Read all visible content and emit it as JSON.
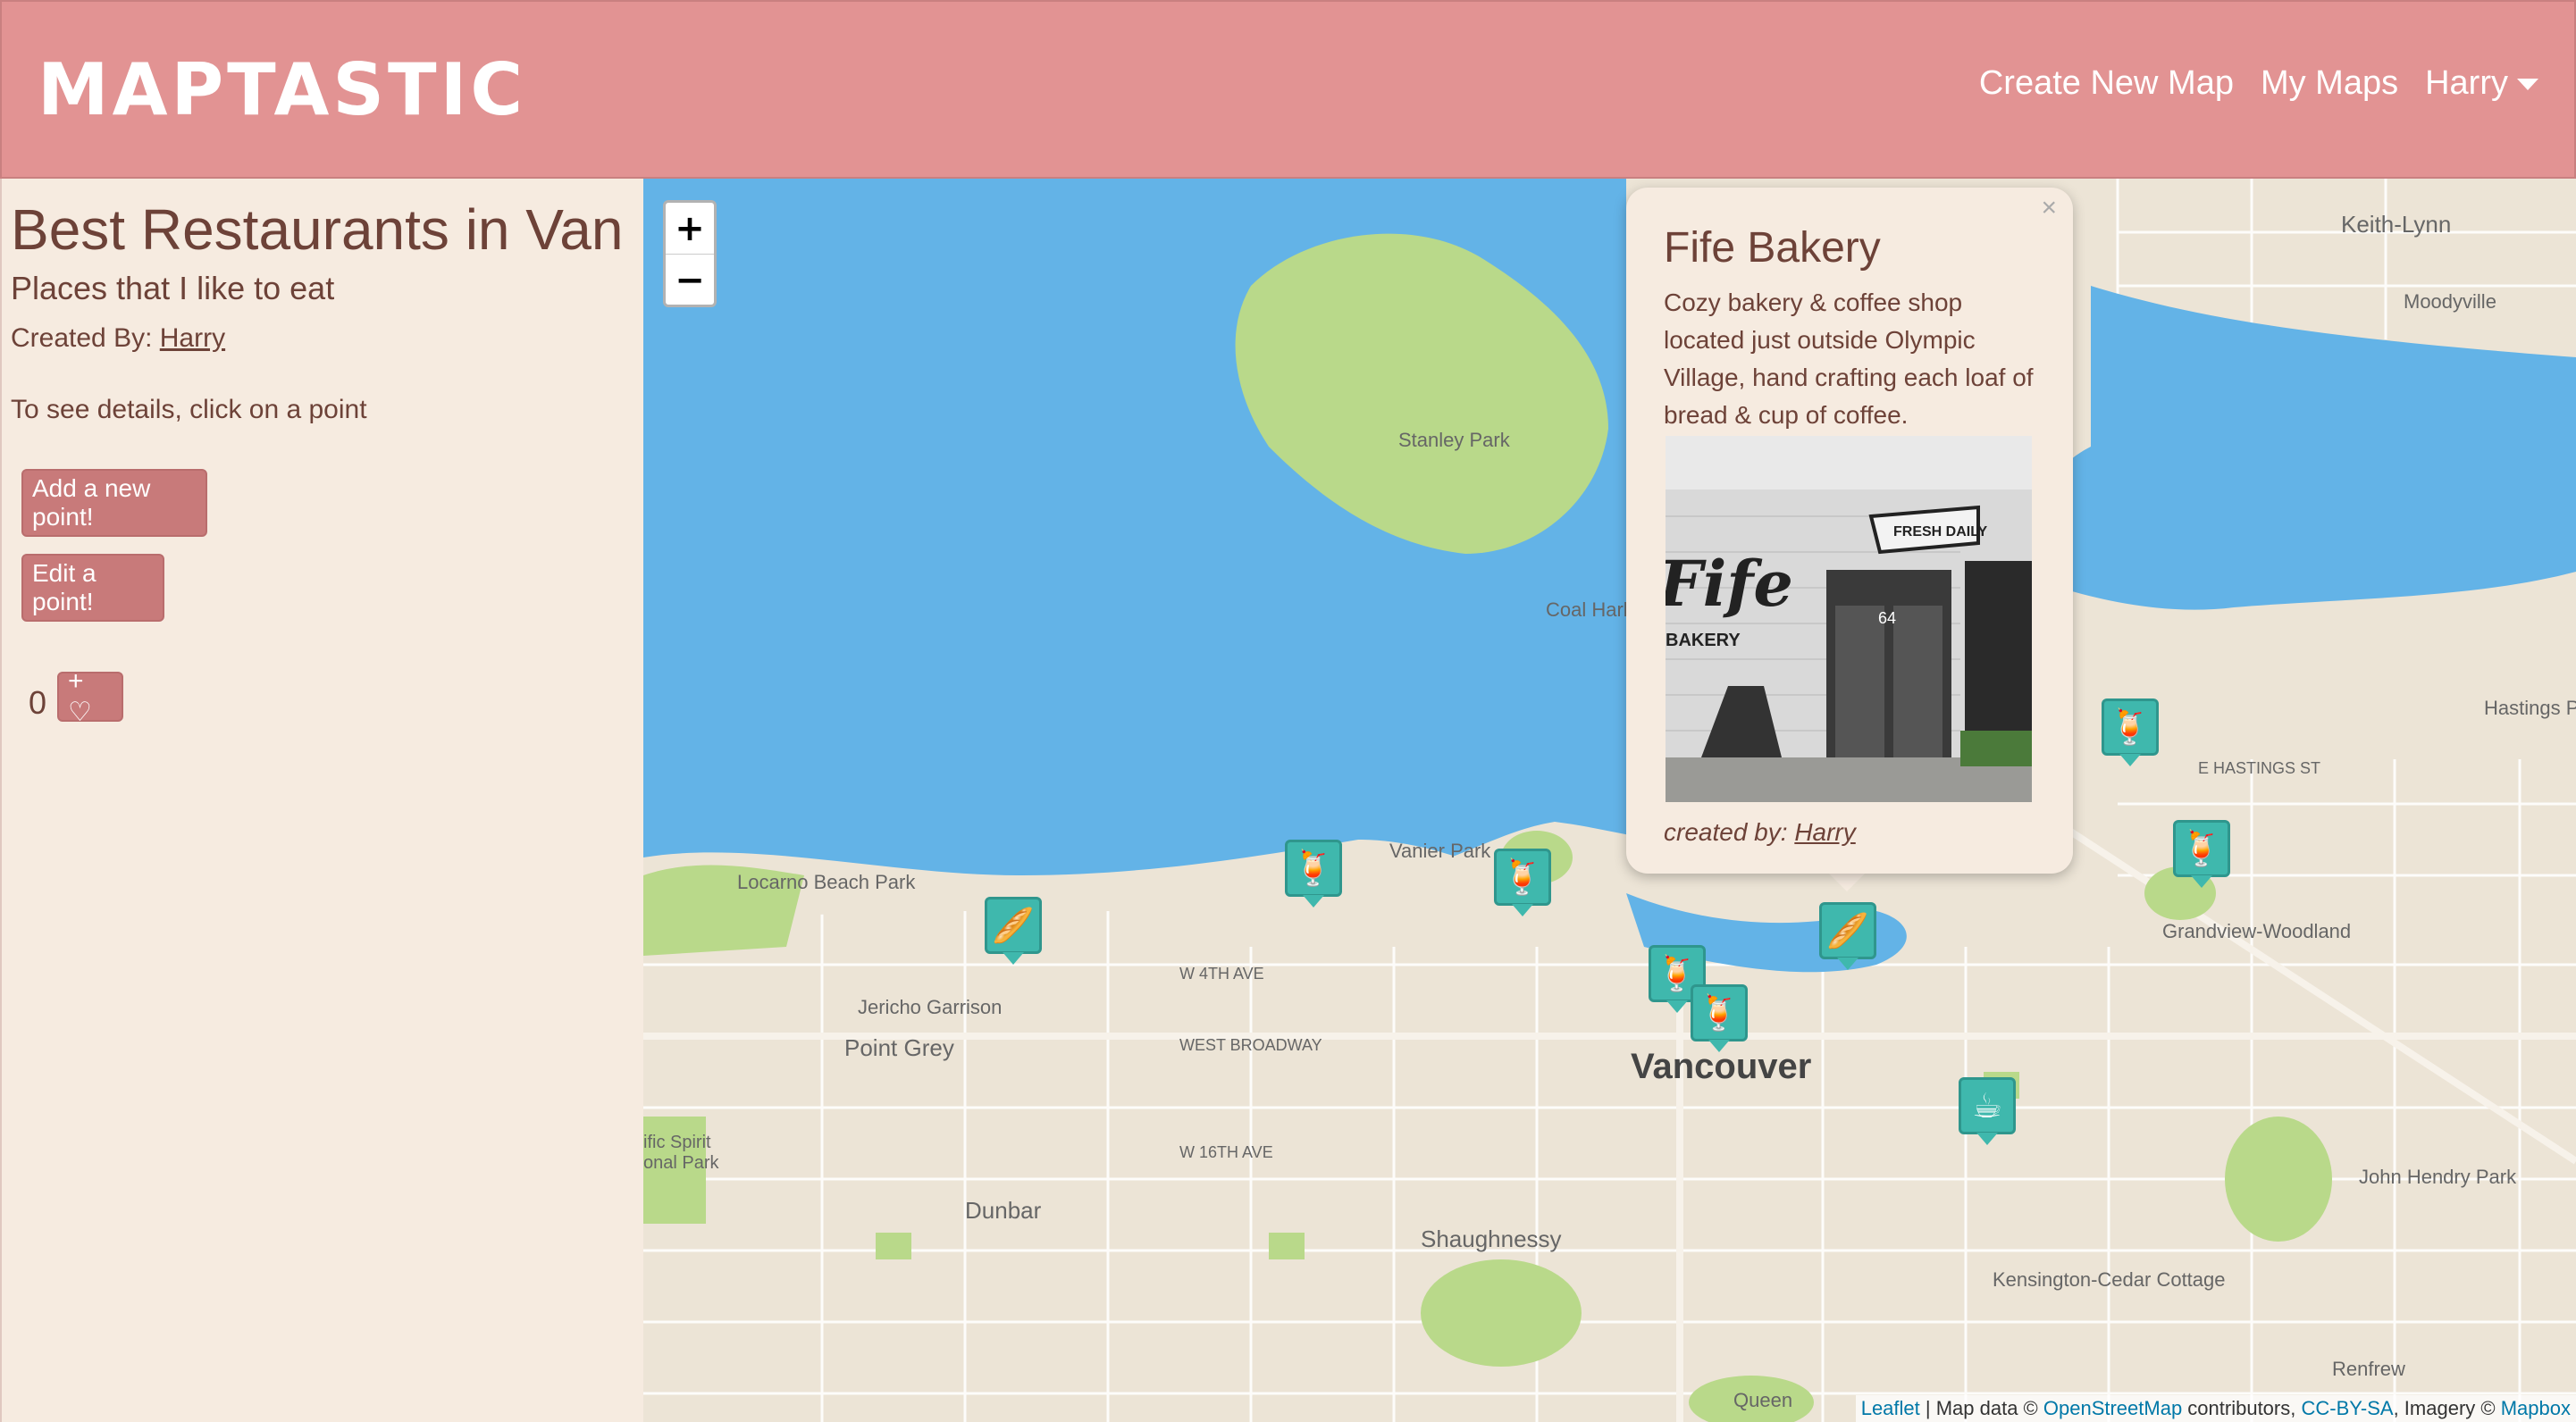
{
  "navbar": {
    "brand": "MAPTASTIC",
    "links": {
      "create": "Create New Map",
      "my_maps": "My Maps",
      "user": "Harry"
    }
  },
  "sidebar": {
    "title": "Best Restaurants in Van",
    "description": "Places that I like to eat",
    "created_by_label": "Created By:",
    "created_by_user": "Harry",
    "hint": "To see details, click on a point",
    "add_point_label": "Add a new point!",
    "edit_point_label": "Edit a point!",
    "like_count": "0",
    "like_button": "+ ♡"
  },
  "map": {
    "zoom_in": "+",
    "zoom_out": "−",
    "labels": {
      "stanley_park": "Stanley Park",
      "coal_harbour": "Coal Harbour",
      "vanier_park": "Vanier Park",
      "locarno": "Locarno Beach Park",
      "jericho": "Jericho Garrison",
      "point_grey": "Point Grey",
      "vancouver": "Vancouver",
      "dunbar": "Dunbar",
      "shaughnessy": "Shaughnessy",
      "grandview": "Grandview-Woodland",
      "kensington": "Kensington-Cedar Cottage",
      "hastings_park": "Hastings Park",
      "john_hendry": "John Hendry Park",
      "keith_lynn": "Keith-Lynn",
      "moodyville": "Moodyville",
      "renfrew": "Renfrew",
      "queen": "Queen",
      "west_broadway": "WEST BROADWAY",
      "w_4th": "W 4TH AVE",
      "w_16th": "W 16TH AVE",
      "e_hastings": "E HASTINGS ST",
      "spirit": "ific Spirit onal Park"
    },
    "marker_icons": [
      "fast-food-icon",
      "bread-icon",
      "coffee-icon"
    ]
  },
  "popup": {
    "title": "Fife Bakery",
    "description": "Cozy bakery & coffee shop located just outside Olympic Village, hand crafting each loaf of bread & cup of coffee.",
    "author_label": "created by:",
    "author": "Harry",
    "close": "×",
    "photo_sign_name": "Fife",
    "photo_sign_fresh": "FRESH DAILY",
    "photo_door_number": "64",
    "photo_bakery_text": "BAKERY"
  },
  "attribution": {
    "leaflet": "Leaflet",
    "map_data": " | Map data © ",
    "osm": "OpenStreetMap",
    "contributors": " contributors, ",
    "license": "CC-BY-SA",
    "imagery": ", Imagery © ",
    "mapbox": "Mapbox"
  },
  "colors": {
    "navbar": "#e29393",
    "sidebar_bg": "#f6ebe0",
    "text": "#6d4238",
    "button": "#c87a7a",
    "water": "#63b3e7",
    "park": "#b9d98a",
    "marker": "#3fb8ad"
  }
}
